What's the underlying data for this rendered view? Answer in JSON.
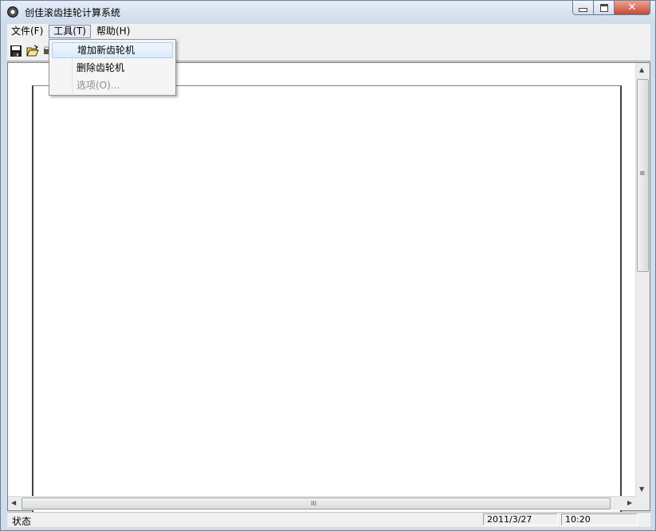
{
  "window": {
    "title": "创佳滚齿挂轮计算系统",
    "close_glyph": "✕"
  },
  "menubar": {
    "items": [
      "文件(F)",
      "工具(T)",
      "帮助(H)"
    ]
  },
  "tools_menu": {
    "items": [
      {
        "label": "增加新齿轮机",
        "enabled": true
      },
      {
        "label": "删除齿轮机",
        "enabled": true
      },
      {
        "label": "选项(O)...",
        "enabled": false
      }
    ]
  },
  "toolbar": {
    "icons": [
      "save-icon",
      "open-folder-icon",
      "print-icon"
    ]
  },
  "scrollbar": {
    "up": "▲",
    "down": "▼",
    "left": "◀",
    "right": "▶",
    "grip_v": "≡",
    "grip_h": "III"
  },
  "statusbar": {
    "text": "状态",
    "date": "2011/3/27",
    "time": "10:20"
  },
  "colors": {
    "accent": "#cfdceb",
    "close_button": "#c74a34"
  }
}
